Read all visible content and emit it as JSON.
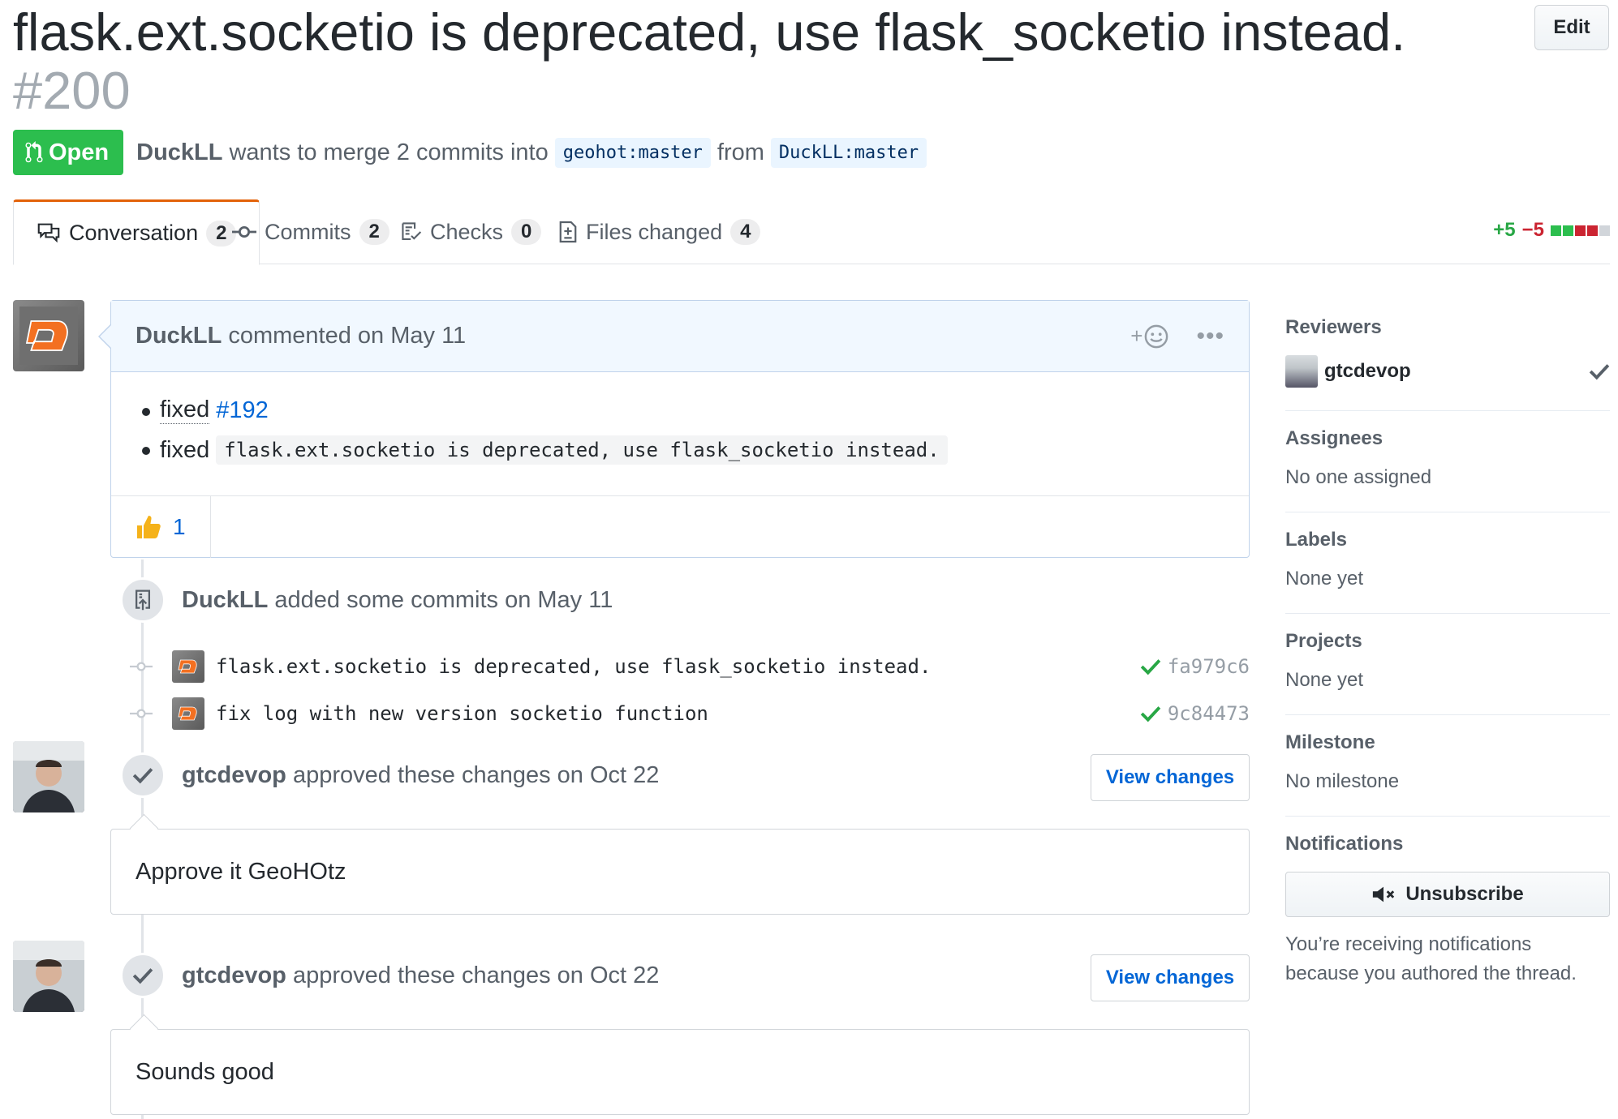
{
  "pr": {
    "title": "flask.ext.socketio is deprecated, use flask_socketio instead.",
    "number": "#200",
    "edit_label": "Edit",
    "state": "Open",
    "author": "DuckLL",
    "merge_text": "wants to merge 2 commits into",
    "base_branch": "geohot:master",
    "from_text": "from",
    "head_branch": "DuckLL:master"
  },
  "tabs": [
    {
      "label": "Conversation",
      "count": "2",
      "icon": "comment-discussion-icon"
    },
    {
      "label": "Commits",
      "count": "2",
      "icon": "git-commit-icon"
    },
    {
      "label": "Checks",
      "count": "0",
      "icon": "checklist-icon"
    },
    {
      "label": "Files changed",
      "count": "4",
      "icon": "diff-icon"
    }
  ],
  "diffstat": {
    "additions": "+5",
    "deletions": "−5"
  },
  "comment": {
    "author": "DuckLL",
    "meta": "commented on May 11",
    "items": [
      {
        "word": "fixed",
        "link": "#192"
      },
      {
        "word": "fixed",
        "code": "flask.ext.socketio is deprecated, use flask_socketio instead."
      }
    ],
    "reaction": {
      "emoji": "thumbs-up-icon",
      "count": "1"
    }
  },
  "commits_event": {
    "author": "DuckLL",
    "text": "added some commits on May 11",
    "commits": [
      {
        "message": "flask.ext.socketio is deprecated, use flask_socketio instead.",
        "sha": "fa979c6"
      },
      {
        "message": "fix log with new version socketio function",
        "sha": "9c84473"
      }
    ]
  },
  "reviews": [
    {
      "author": "gtcdevop",
      "text": "approved these changes on Oct 22",
      "button": "View changes",
      "body": "Approve it GeoHOtz"
    },
    {
      "author": "gtcdevop",
      "text": "approved these changes on Oct 22",
      "button": "View changes",
      "body": "Sounds good"
    }
  ],
  "sidebar": {
    "reviewers_heading": "Reviewers",
    "reviewer": "gtcdevop",
    "assignees_heading": "Assignees",
    "assignees_value": "No one assigned",
    "labels_heading": "Labels",
    "labels_value": "None yet",
    "projects_heading": "Projects",
    "projects_value": "None yet",
    "milestone_heading": "Milestone",
    "milestone_value": "No milestone",
    "notifications_heading": "Notifications",
    "unsubscribe_label": "Unsubscribe",
    "notification_note": "You’re receiving notifications because you authored the thread."
  },
  "colors": {
    "open_green": "#2cbe4e",
    "link_blue": "#0366d6",
    "add_green": "#28a745",
    "del_red": "#cb2431"
  }
}
